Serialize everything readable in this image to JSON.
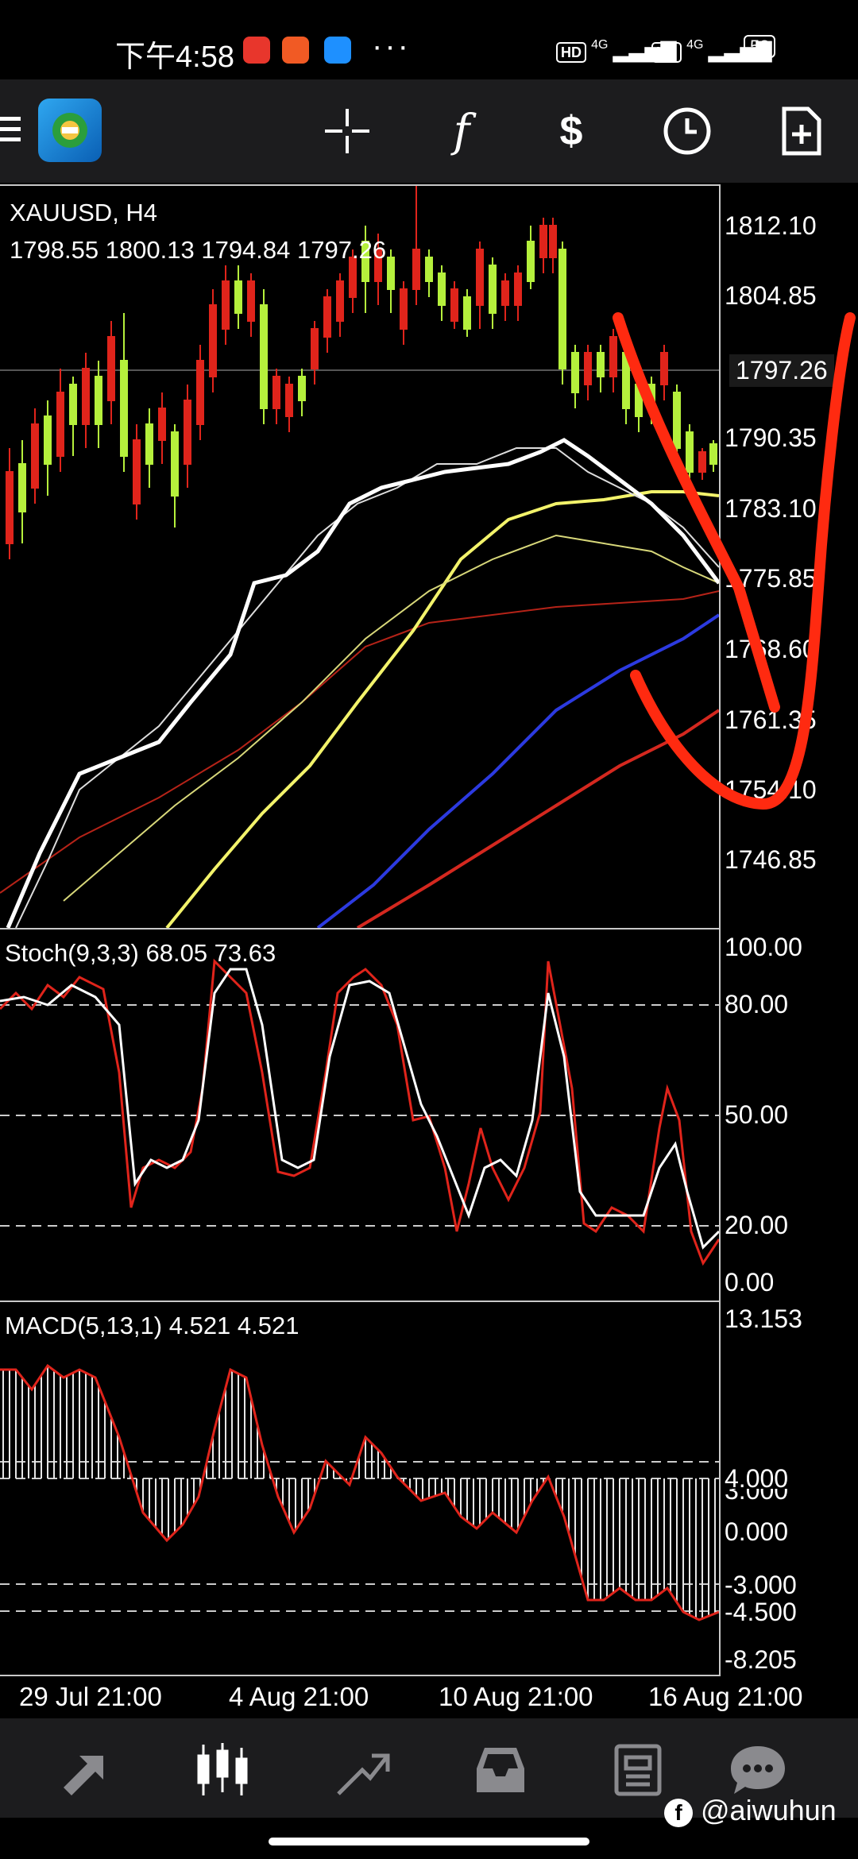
{
  "status": {
    "time": "下午4:58",
    "network1": "4G",
    "network2": "4G",
    "battery": "58"
  },
  "toolbar": {
    "items": [
      "menu-icon",
      "app-logo",
      "crosshair-icon",
      "indicators-icon",
      "trade-icon",
      "history-icon",
      "new-order-icon"
    ]
  },
  "chart": {
    "symbol": "XAUUSD, H4",
    "ohlc": "1798.55 1800.13 1794.84 1797.26",
    "price_axis": [
      "1812.10",
      "1804.85",
      "1790.35",
      "1783.10",
      "1775.85",
      "1768.60",
      "1761.35",
      "1754.10",
      "1746.85"
    ],
    "current_price": "1797.26"
  },
  "stoch": {
    "title": "Stoch(9,3,3) 68.05 73.63",
    "axis": [
      "100.00",
      "80.00",
      "50.00",
      "20.00",
      "0.00"
    ]
  },
  "macd": {
    "title": "MACD(5,13,1) 4.521 4.521",
    "axis": [
      "13.153",
      "4.000",
      "3.000",
      "0.000",
      "-3.000",
      "-4.500",
      "-8.205"
    ]
  },
  "time_axis": [
    "29 Jul 21:00",
    "4 Aug 21:00",
    "10 Aug 21:00",
    "16 Aug 21:00"
  ],
  "nav": {
    "items": [
      "quotes-icon",
      "chart-icon",
      "trade-icon",
      "history-icon",
      "news-icon",
      "messages-icon"
    ]
  },
  "watermark": "@aiwuhun",
  "colors": {
    "bull": "#b5f03c",
    "bear": "#e0241b",
    "ma_white": "#ffffff",
    "ma_yellow": "#f3f36b",
    "ma_blue": "#2c3ae0",
    "ma_red": "#d4281f",
    "annotation": "#ff2a10"
  }
}
